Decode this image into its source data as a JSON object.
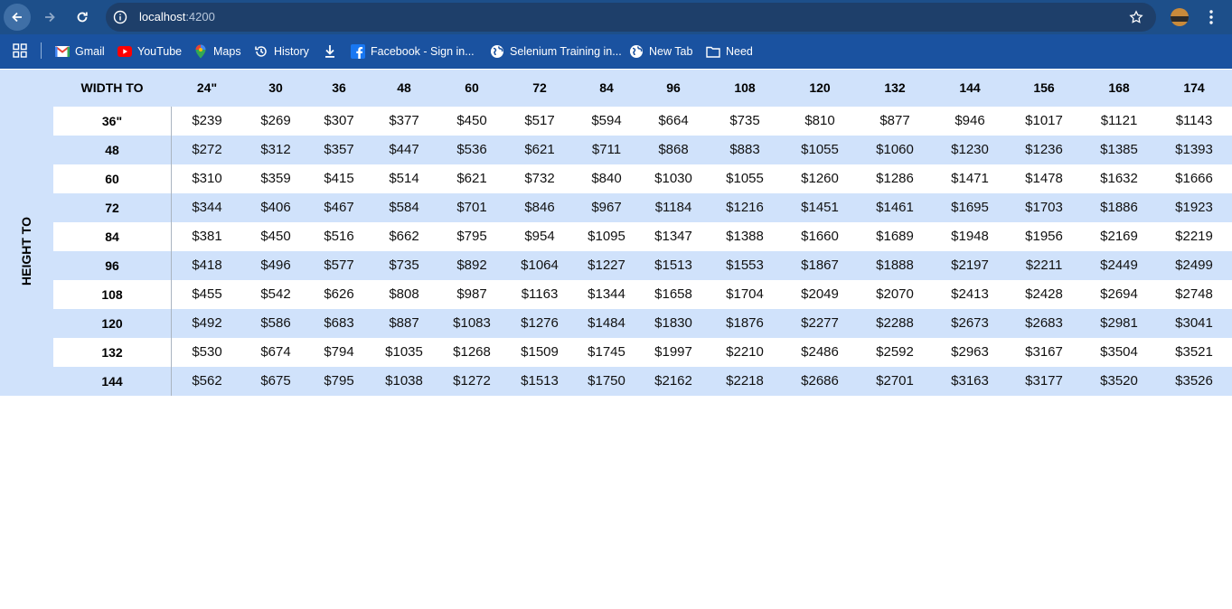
{
  "browser": {
    "url_host": "localhost",
    "url_port": ":4200",
    "bookmarks": [
      {
        "label": "Gmail",
        "icon": "gmail-icon"
      },
      {
        "label": "YouTube",
        "icon": "youtube-icon"
      },
      {
        "label": "Maps",
        "icon": "maps-icon"
      },
      {
        "label": "History",
        "icon": "history-icon"
      },
      {
        "label": "",
        "icon": "download-icon"
      },
      {
        "label": "Facebook - Sign in...",
        "icon": "facebook-icon"
      },
      {
        "label": "Selenium Training in...",
        "icon": "globe-icon"
      },
      {
        "label": "New Tab",
        "icon": "globe-icon"
      },
      {
        "label": "Need",
        "icon": "folder-icon"
      }
    ]
  },
  "table": {
    "width_label": "WIDTH TO",
    "height_label": "HEIGHT TO",
    "columns": [
      "24\"",
      "30",
      "36",
      "48",
      "60",
      "72",
      "84",
      "96",
      "108",
      "120",
      "132",
      "144",
      "156",
      "168",
      "174"
    ],
    "rows": [
      {
        "label": "36\"",
        "values": [
          "$239",
          "$269",
          "$307",
          "$377",
          "$450",
          "$517",
          "$594",
          "$664",
          "$735",
          "$810",
          "$877",
          "$946",
          "$1017",
          "$1121",
          "$1143"
        ]
      },
      {
        "label": "48",
        "values": [
          "$272",
          "$312",
          "$357",
          "$447",
          "$536",
          "$621",
          "$711",
          "$868",
          "$883",
          "$1055",
          "$1060",
          "$1230",
          "$1236",
          "$1385",
          "$1393"
        ]
      },
      {
        "label": "60",
        "values": [
          "$310",
          "$359",
          "$415",
          "$514",
          "$621",
          "$732",
          "$840",
          "$1030",
          "$1055",
          "$1260",
          "$1286",
          "$1471",
          "$1478",
          "$1632",
          "$1666"
        ]
      },
      {
        "label": "72",
        "values": [
          "$344",
          "$406",
          "$467",
          "$584",
          "$701",
          "$846",
          "$967",
          "$1184",
          "$1216",
          "$1451",
          "$1461",
          "$1695",
          "$1703",
          "$1886",
          "$1923"
        ]
      },
      {
        "label": "84",
        "values": [
          "$381",
          "$450",
          "$516",
          "$662",
          "$795",
          "$954",
          "$1095",
          "$1347",
          "$1388",
          "$1660",
          "$1689",
          "$1948",
          "$1956",
          "$2169",
          "$2219"
        ]
      },
      {
        "label": "96",
        "values": [
          "$418",
          "$496",
          "$577",
          "$735",
          "$892",
          "$1064",
          "$1227",
          "$1513",
          "$1553",
          "$1867",
          "$1888",
          "$2197",
          "$2211",
          "$2449",
          "$2499"
        ]
      },
      {
        "label": "108",
        "values": [
          "$455",
          "$542",
          "$626",
          "$808",
          "$987",
          "$1163",
          "$1344",
          "$1658",
          "$1704",
          "$2049",
          "$2070",
          "$2413",
          "$2428",
          "$2694",
          "$2748"
        ]
      },
      {
        "label": "120",
        "values": [
          "$492",
          "$586",
          "$683",
          "$887",
          "$1083",
          "$1276",
          "$1484",
          "$1830",
          "$1876",
          "$2277",
          "$2288",
          "$2673",
          "$2683",
          "$2981",
          "$3041"
        ]
      },
      {
        "label": "132",
        "values": [
          "$530",
          "$674",
          "$794",
          "$1035",
          "$1268",
          "$1509",
          "$1745",
          "$1997",
          "$2210",
          "$2486",
          "$2592",
          "$2963",
          "$3167",
          "$3504",
          "$3521"
        ]
      },
      {
        "label": "144",
        "values": [
          "$562",
          "$675",
          "$795",
          "$1038",
          "$1272",
          "$1513",
          "$1750",
          "$2162",
          "$2218",
          "$2686",
          "$2701",
          "$3163",
          "$3177",
          "$3520",
          "$3526"
        ]
      }
    ]
  },
  "colors": {
    "header_bg": "#d0e2fb",
    "chrome_top": "#1d4f8a",
    "chrome_bookmarks": "#1a52a0"
  }
}
